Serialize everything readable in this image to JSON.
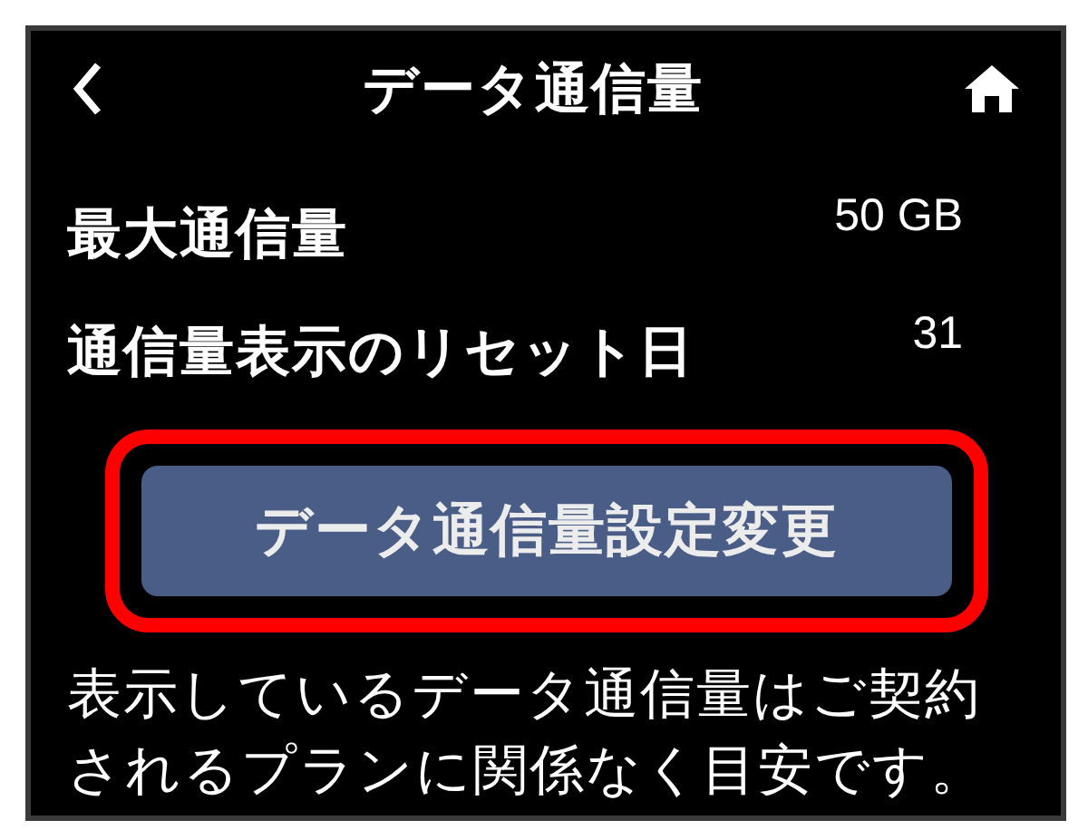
{
  "header": {
    "title": "データ通信量"
  },
  "rows": [
    {
      "label": "最大通信量",
      "value": "50 GB"
    },
    {
      "label": "通信量表示のリセット日",
      "value": "31"
    }
  ],
  "button": {
    "label": "データ通信量設定変更",
    "highlighted": true
  },
  "note": "表示しているデータ通信量はご契約されるプランに関係なく目安です。"
}
